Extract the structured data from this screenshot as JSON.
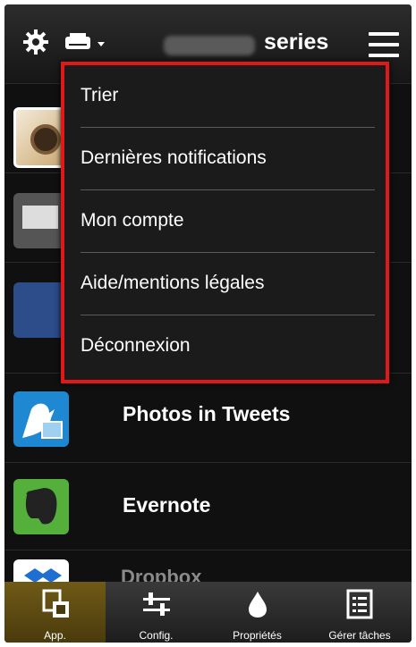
{
  "header": {
    "series_label": "series",
    "icons": [
      "gear-icon",
      "printer-icon",
      "hamburger-menu-icon"
    ]
  },
  "menu": {
    "items": [
      {
        "label": "Trier"
      },
      {
        "label": "Dernières notifications"
      },
      {
        "label": "Mon compte"
      },
      {
        "label": "Aide/mentions légales"
      },
      {
        "label": "Déconnexion"
      }
    ],
    "highlight_color": "#e01818"
  },
  "apps": [
    {
      "label": "Photos in Tweets",
      "icon": "bird-photo-icon"
    },
    {
      "label": "Evernote",
      "icon": "evernote-elephant-icon"
    },
    {
      "label": "Dropbox",
      "icon": "dropbox-icon"
    }
  ],
  "bottom_tabs": [
    {
      "label": "App.",
      "icon": "app-icon",
      "active": true
    },
    {
      "label": "Config.",
      "icon": "sliders-icon",
      "active": false
    },
    {
      "label": "Propriétés",
      "icon": "ink-drop-icon",
      "active": false
    },
    {
      "label": "Gérer tâches",
      "icon": "checklist-icon",
      "active": false
    }
  ]
}
